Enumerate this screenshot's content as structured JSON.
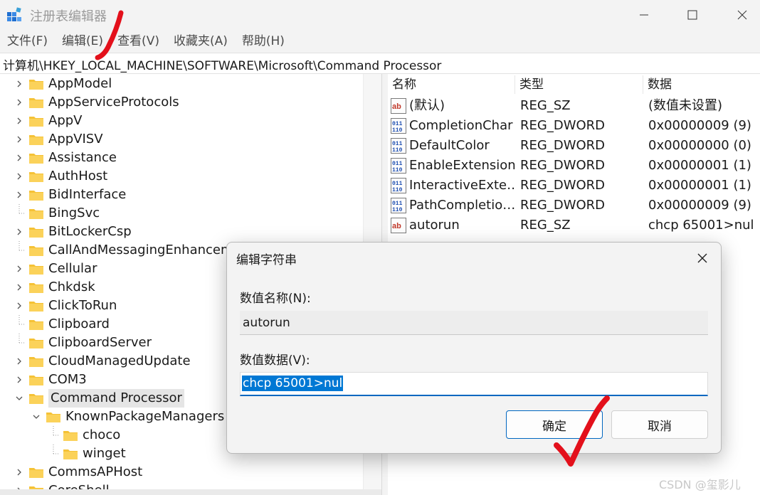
{
  "window": {
    "title": "注册表编辑器"
  },
  "menu": [
    "文件(F)",
    "编辑(E)",
    "查看(V)",
    "收藏夹(A)",
    "帮助(H)"
  ],
  "address": "计算机\\HKEY_LOCAL_MACHINE\\SOFTWARE\\Microsoft\\Command Processor",
  "tree": [
    {
      "label": "AppModel",
      "expander": "right"
    },
    {
      "label": "AppServiceProtocols",
      "expander": "right"
    },
    {
      "label": "AppV",
      "expander": "right"
    },
    {
      "label": "AppVISV",
      "expander": "right"
    },
    {
      "label": "Assistance",
      "expander": "right"
    },
    {
      "label": "AuthHost",
      "expander": "right"
    },
    {
      "label": "BidInterface",
      "expander": "right"
    },
    {
      "label": "BingSvc",
      "expander": "none"
    },
    {
      "label": "BitLockerCsp",
      "expander": "right"
    },
    {
      "label": "CallAndMessagingEnhancement",
      "expander": "none"
    },
    {
      "label": "Cellular",
      "expander": "right"
    },
    {
      "label": "Chkdsk",
      "expander": "right"
    },
    {
      "label": "ClickToRun",
      "expander": "right"
    },
    {
      "label": "Clipboard",
      "expander": "none"
    },
    {
      "label": "ClipboardServer",
      "expander": "none"
    },
    {
      "label": "CloudManagedUpdate",
      "expander": "right"
    },
    {
      "label": "COM3",
      "expander": "right"
    },
    {
      "label": "Command Processor",
      "expander": "down",
      "selected": true
    },
    {
      "label": "KnownPackageManagers",
      "expander": "down",
      "level": 1
    },
    {
      "label": "choco",
      "expander": "none",
      "level": 2
    },
    {
      "label": "winget",
      "expander": "none",
      "level": 2
    },
    {
      "label": "CommsAPHost",
      "expander": "right"
    },
    {
      "label": "CoreShell",
      "expander": "right"
    }
  ],
  "values_header": {
    "name": "名称",
    "type": "类型",
    "data": "数据"
  },
  "values": [
    {
      "icon": "string-value-icon",
      "name": "(默认)",
      "type": "REG_SZ",
      "data": "(数值未设置)"
    },
    {
      "icon": "dword-value-icon",
      "name": "CompletionChar",
      "type": "REG_DWORD",
      "data": "0x00000009 (9)"
    },
    {
      "icon": "dword-value-icon",
      "name": "DefaultColor",
      "type": "REG_DWORD",
      "data": "0x00000000 (0)"
    },
    {
      "icon": "dword-value-icon",
      "name": "EnableExtensions",
      "type": "REG_DWORD",
      "data": "0x00000001 (1)"
    },
    {
      "icon": "dword-value-icon",
      "name": "InteractiveExte…",
      "type": "REG_DWORD",
      "data": "0x00000001 (1)"
    },
    {
      "icon": "dword-value-icon",
      "name": "PathCompletio…",
      "type": "REG_DWORD",
      "data": "0x00000009 (9)"
    },
    {
      "icon": "string-value-icon",
      "name": "autorun",
      "type": "REG_SZ",
      "data": "chcp 65001>nul"
    }
  ],
  "dialog": {
    "title": "编辑字符串",
    "name_label": "数值名称(N):",
    "name_value": "autorun",
    "data_label": "数值数据(V):",
    "data_value": "chcp 65001>nul",
    "ok": "确定",
    "cancel": "取消"
  },
  "watermark": "CSDN @玺影儿",
  "colors": {
    "accent": "#0067c0",
    "selection": "#0078d4",
    "annotation": "#e3101b",
    "folder": "#f7c948"
  }
}
